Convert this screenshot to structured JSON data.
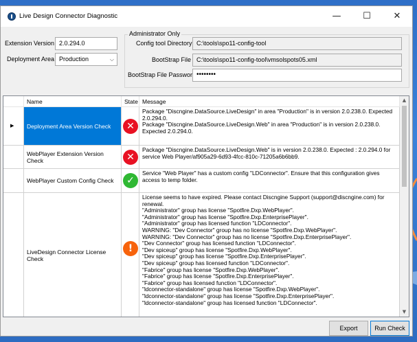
{
  "window": {
    "title": "Live Design Connector Diagnostic",
    "minimize_glyph": "—",
    "maximize_glyph": "☐",
    "close_glyph": "✕"
  },
  "form": {
    "extension_version_label": "Extension Version :",
    "extension_version_value": "2.0.294.0",
    "deployment_area_label": "Deployment Area :",
    "deployment_area_value": "Production",
    "dropdown_glyph": "⌵"
  },
  "admin": {
    "group_label": "Administrator Only",
    "config_dir_label": "Config tool Directory :",
    "config_dir_value": "C:\\tools\\spo11-config-tool",
    "bootstrap_file_label": "BootStrap File :",
    "bootstrap_file_value": "C:\\tools\\spo11-config-tool\\vmsolspots05.xml",
    "bootstrap_pwd_label": "BootStrap File Password :",
    "bootstrap_pwd_value": "••••••••"
  },
  "grid": {
    "columns": [
      "Name",
      "State",
      "Message"
    ],
    "selected_row_glyph": "▶",
    "scroll_up": "▲",
    "scroll_down": "▼",
    "rows": [
      {
        "name": "Deployment Area Version Check",
        "state": "error",
        "state_glyph": "✕",
        "message": "Package \"Discngine.DataSource.LiveDesign\" in area \"Production\" is in version 2.0.238.0. Expected 2.0.294.0.\nPackage \"Discngine.DataSource.LiveDesign.Web\" in area \"Production\" is in version 2.0.238.0. Expected 2.0.294.0."
      },
      {
        "name": "WebPlayer Extension Version Check",
        "state": "error",
        "state_glyph": "✕",
        "message": "Package \"Discngine.DataSource.LiveDesign.Web\" is in version 2.0.238.0. Expected : 2.0.294.0 for service Web Player/af905a29-6d93-4fcc-810c-71205a6b6bb9."
      },
      {
        "name": "WebPlayer Custom Config Check",
        "state": "ok",
        "state_glyph": "✓",
        "message": "Service \"Web Player\" has a custom config \"LDConnector\". Ensure that this configuration gives access to temp folder."
      },
      {
        "name": "LiveDesign Connector License Check",
        "state": "warning",
        "state_glyph": "!",
        "message": "License seems to have expired. Please contact Discngine Support (support@discngine.com) for renewal.\n\"Administrator\" group has license \"Spotfire.Dxp.WebPlayer\".\n\"Administrator\" group has license \"Spotfire.Dxp.EnterprisePlayer\".\n\"Administrator\" group has licensed function \"LDConnector\".\nWARNING: \"Dev Connector\" group has no license \"Spotfire.Dxp.WebPlayer\".\nWARNING: \"Dev Connector\" group has no license \"Spotfire.Dxp.EnterprisePlayer\".\n\"Dev Connector\" group has licensed function \"LDConnector\".\n\"Dev spiceup\" group has license \"Spotfire.Dxp.WebPlayer\".\n\"Dev spiceup\" group has license \"Spotfire.Dxp.EnterprisePlayer\".\n\"Dev spiceup\" group has licensed function \"LDConnector\".\n\"Fabrice\" group has license \"Spotfire.Dxp.WebPlayer\".\n\"Fabrice\" group has license \"Spotfire.Dxp.EnterprisePlayer\".\n\"Fabrice\" group has licensed function \"LDConnector\".\n\"ldconnector-standalone\" group has license \"Spotfire.Dxp.WebPlayer\".\n\"ldconnector-standalone\" group has license \"Spotfire.Dxp.EnterprisePlayer\".\n\"ldconnector-standalone\" group has licensed function \"LDConnector\"."
      }
    ]
  },
  "buttons": {
    "export_label": "Export",
    "run_check_label": "Run Check"
  },
  "colors": {
    "error": "#e81123",
    "ok": "#2fb833",
    "warning": "#f7630c",
    "selection": "#0078d7"
  }
}
